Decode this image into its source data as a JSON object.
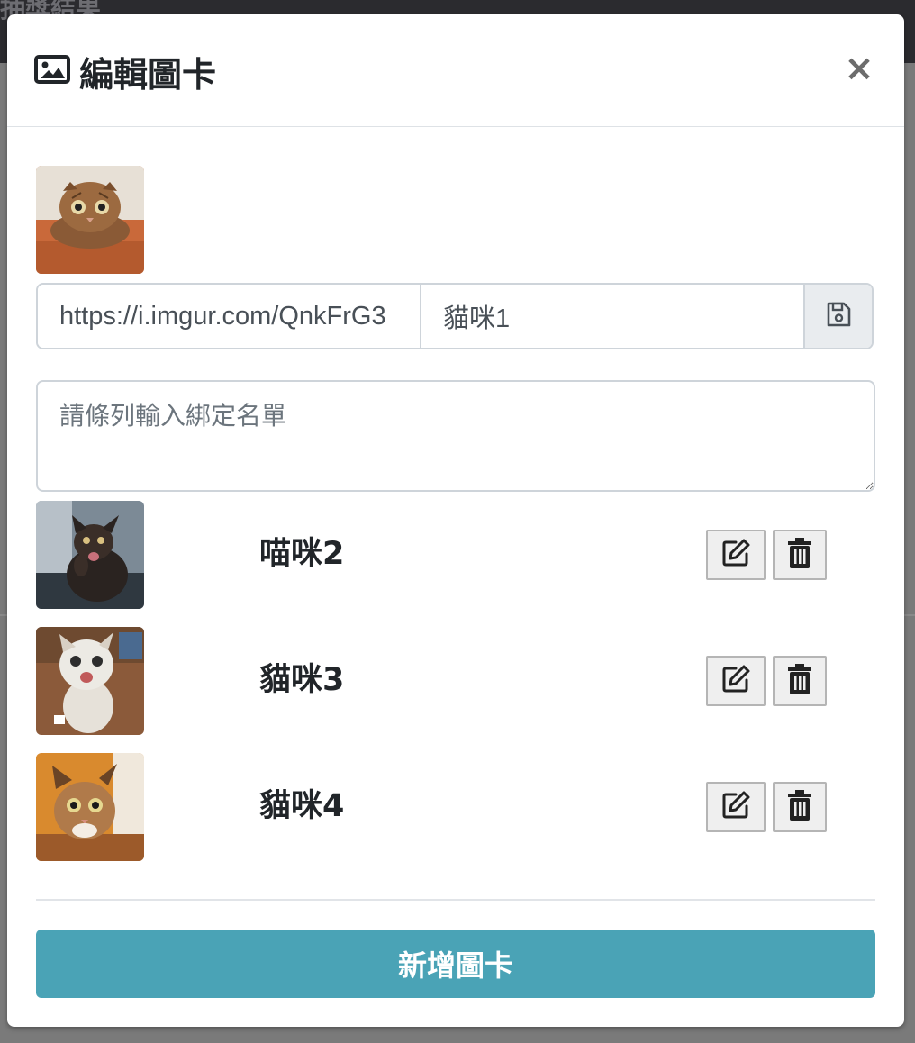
{
  "background": {
    "title_fragment": "抽獎結果"
  },
  "modal": {
    "title": "編輯圖卡",
    "title_icon": "image-icon",
    "close_label": "×"
  },
  "current_card": {
    "image_url_value": "https://i.imgur.com/QnkFrG3",
    "name_value": "貓咪1",
    "save_icon": "floppy-disk-icon"
  },
  "bind_list": {
    "placeholder": "請條列輸入綁定名單"
  },
  "cards": [
    {
      "name": "喵咪2",
      "edit_icon": "edit-icon",
      "delete_icon": "trash-icon"
    },
    {
      "name": "貓咪3",
      "edit_icon": "edit-icon",
      "delete_icon": "trash-icon"
    },
    {
      "name": "貓咪4",
      "edit_icon": "edit-icon",
      "delete_icon": "trash-icon"
    }
  ],
  "footer": {
    "add_button_label": "新增圖卡"
  },
  "colors": {
    "accent": "#4aa3b6",
    "border": "#ced4da",
    "addon_bg": "#e9ecef"
  }
}
